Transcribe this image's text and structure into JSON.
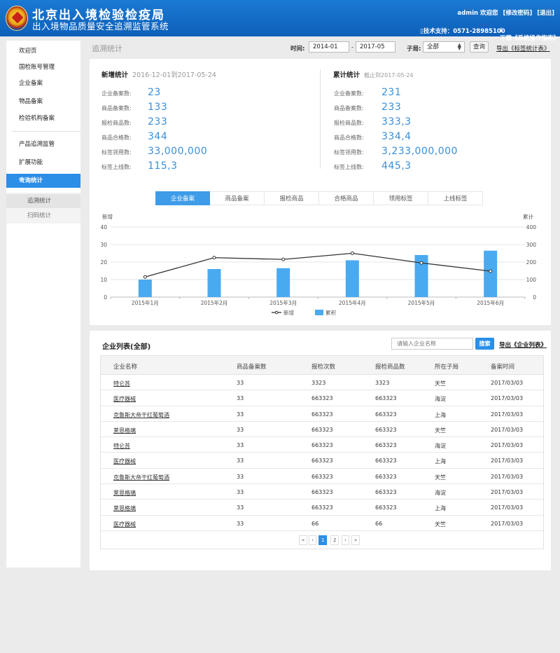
{
  "header": {
    "title": "北京出入境检验检疫局",
    "subtitle": "出入境物品质量安全追溯监管系统",
    "user_welcome": "admin 欢迎您",
    "change_password": "[修改密码]",
    "logout": "[退出]",
    "tech_support": "技术支持：0571-28985100",
    "download_guide": "下载《系统操作指南》"
  },
  "sidebar": {
    "items": [
      {
        "label": "欢迎页"
      },
      {
        "label": "国检账号管理"
      },
      {
        "label": "企业备案"
      },
      {
        "label": "物品备案"
      },
      {
        "label": "检验机构备案"
      },
      {
        "label": "产品追溯监管"
      },
      {
        "label": "扩展功能"
      },
      {
        "label": "查询统计"
      }
    ],
    "subitems": [
      {
        "label": "追溯统计"
      },
      {
        "label": "扫码统计"
      }
    ]
  },
  "filter": {
    "page_title": "追溯统计",
    "time_label": "时间:",
    "date_from": "2014-01",
    "dash": "-",
    "date_to": "2017-05",
    "sub_label": "子局:",
    "sub_value": "全部",
    "query_btn": "查询",
    "export_link": "导出《标签统计表》"
  },
  "stats": {
    "new": {
      "title": "新增统计",
      "range": "2016-12-01到2017-05-24",
      "rows": [
        {
          "label": "企业备案数:",
          "value": "23"
        },
        {
          "label": "商品备案数:",
          "value": "133"
        },
        {
          "label": "报检商品数:",
          "value": "233"
        },
        {
          "label": "商品合格数:",
          "value": "344"
        },
        {
          "label": "标签领用数:",
          "value": "33,000,000"
        },
        {
          "label": "标签上线数:",
          "value": "115,3"
        }
      ]
    },
    "total": {
      "title": "累计统计",
      "range": "截止到2017-05-24",
      "rows": [
        {
          "label": "企业备案数:",
          "value": "231"
        },
        {
          "label": "商品备案数:",
          "value": "233"
        },
        {
          "label": "报检商品数:",
          "value": "333,3"
        },
        {
          "label": "商品合格数:",
          "value": "334,4"
        },
        {
          "label": "标签领用数:",
          "value": "3,233,000,000"
        },
        {
          "label": "标签上线数:",
          "value": "445,3"
        }
      ]
    }
  },
  "tabs": [
    {
      "label": "企业备案"
    },
    {
      "label": "商品备案"
    },
    {
      "label": "报检商品"
    },
    {
      "label": "合格商品"
    },
    {
      "label": "领用标签"
    },
    {
      "label": "上线标签"
    }
  ],
  "chart_data": {
    "type": "bar",
    "categories": [
      "2015年1月",
      "2015年2月",
      "2015年3月",
      "2015年4月",
      "2015年5月",
      "2015年6月"
    ],
    "left_axis_label": "新增",
    "right_axis_label": "累计",
    "left_ylim": [
      0,
      40
    ],
    "right_ylim": [
      0,
      400
    ],
    "left_ticks": [
      0,
      10,
      20,
      30,
      40
    ],
    "right_ticks": [
      0,
      100,
      200,
      300,
      400
    ],
    "series": [
      {
        "name": "累积",
        "type": "bar",
        "axis": "right",
        "color": "#4aaaf0",
        "values": [
          100,
          160,
          165,
          210,
          240,
          265
        ]
      },
      {
        "name": "新增",
        "type": "line",
        "axis": "left",
        "color": "#333333",
        "values": [
          11.5,
          22.5,
          21.5,
          25,
          19.5,
          14.8
        ]
      }
    ],
    "legend_position": "bottom",
    "grid": true
  },
  "company_list": {
    "title": "企业列表(全部)",
    "search_placeholder": "请输入企业名称",
    "search_btn": "搜索",
    "export_link": "导出《企业列表》",
    "columns": [
      "企业名称",
      "商品备案数",
      "报检次数",
      "报检商品数",
      "所在子局",
      "备案时间"
    ],
    "rows": [
      [
        "特仑苏",
        "33",
        "3323",
        "3323",
        "天竺",
        "2017/03/03"
      ],
      [
        "医疗器械",
        "33",
        "663323",
        "663323",
        "海淀",
        "2017/03/03"
      ],
      [
        "克鲁斯大帝干红葡萄酒",
        "33",
        "663323",
        "663323",
        "上海",
        "2017/03/03"
      ],
      [
        "莱恩格璃",
        "33",
        "663323",
        "663323",
        "天竺",
        "2017/03/03"
      ],
      [
        "特仑苏",
        "33",
        "663323",
        "663323",
        "海淀",
        "2017/03/03"
      ],
      [
        "医疗器械",
        "33",
        "663323",
        "663323",
        "上海",
        "2017/03/03"
      ],
      [
        "克鲁斯大帝干红葡萄酒",
        "33",
        "663323",
        "663323",
        "天竺",
        "2017/03/03"
      ],
      [
        "莱恩格璃",
        "33",
        "663323",
        "663323",
        "海淀",
        "2017/03/03"
      ],
      [
        "莱恩格璃",
        "33",
        "663323",
        "663323",
        "上海",
        "2017/03/03"
      ],
      [
        "医疗器械",
        "33",
        "66",
        "66",
        "天竺",
        "2017/03/03"
      ]
    ],
    "pagination": {
      "first": "«",
      "prev": "‹",
      "pages": [
        "1",
        "2"
      ],
      "current": "1",
      "next": "›",
      "last": "»"
    }
  }
}
